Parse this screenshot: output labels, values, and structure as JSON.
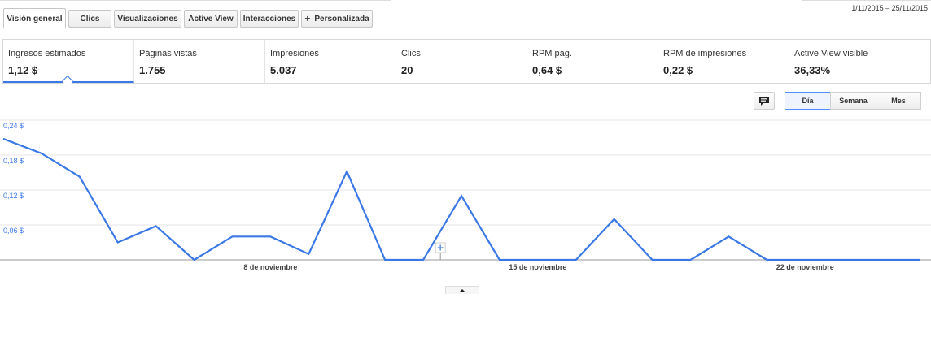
{
  "tabs": [
    {
      "label": "Visión general",
      "active": true
    },
    {
      "label": "Clics",
      "active": false
    },
    {
      "label": "Visualizaciones",
      "active": false
    },
    {
      "label": "Active View",
      "active": false
    },
    {
      "label": "Interacciones",
      "active": false
    },
    {
      "label": "Personalizada",
      "active": false,
      "icon": "plus-icon"
    }
  ],
  "date_range": "1/11/2015 – 25/11/2015",
  "metrics": [
    {
      "label": "Ingresos estimados",
      "value": "1,12 $",
      "active": true
    },
    {
      "label": "Páginas vistas",
      "value": "1.755"
    },
    {
      "label": "Impresiones",
      "value": "5.037"
    },
    {
      "label": "Clics",
      "value": "20"
    },
    {
      "label": "RPM pág.",
      "value": "0,64 $"
    },
    {
      "label": "RPM de impresiones",
      "value": "0,22 $"
    },
    {
      "label": "Active View visible",
      "value": "36,33%"
    }
  ],
  "annotation_icon": "speech-bubble-icon",
  "granularity": {
    "options": [
      "Día",
      "Semana",
      "Mes"
    ],
    "selected": "Día"
  },
  "accent_color": "#3b78e7",
  "collapse_icon": "triangle-up-icon",
  "chart_data": {
    "type": "line",
    "series": [
      {
        "values": [
          0.208,
          0.183,
          0.143,
          0.03,
          0.058,
          0.0,
          0.04,
          0.04,
          0.01,
          0.152,
          0.0,
          0.0,
          0.11,
          0.0,
          0.0,
          0.0,
          0.07,
          0.0,
          0.0,
          0.04,
          0.0,
          0.0,
          0.0,
          0.0,
          0.0
        ]
      }
    ],
    "yticks": [
      "0,24 $",
      "0,18 $",
      "0,12 $",
      "0,06 $"
    ],
    "ytick_values": [
      0.24,
      0.18,
      0.12,
      0.06
    ],
    "ylim": [
      0,
      0.24
    ],
    "x_tick_labels": [
      {
        "label": "8 de noviembre",
        "day": 8
      },
      {
        "label": "15 de noviembre",
        "day": 15
      },
      {
        "label": "22 de noviembre",
        "day": 22
      }
    ],
    "grid": true,
    "color": "#3b78e7"
  }
}
